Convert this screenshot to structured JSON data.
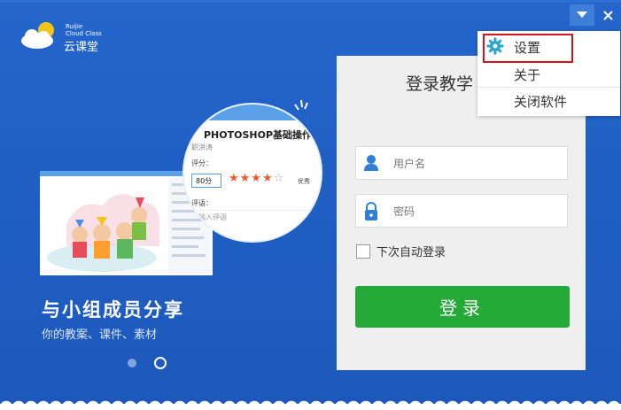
{
  "brand": {
    "name_en_1": "Ruijie",
    "name_en_2": "Cloud Class",
    "name_cn": "云课堂"
  },
  "window_controls": {
    "menu_icon": "chevron-down-icon",
    "close_icon": "close-icon"
  },
  "menu": {
    "items": [
      {
        "label": "设置",
        "icon": "gear-icon"
      },
      {
        "label": "关于"
      },
      {
        "label": "关闭软件"
      }
    ]
  },
  "slide": {
    "title": "与小组成员分享",
    "subtitle": "你的教案、课件、素材",
    "active_index": 1,
    "count": 2,
    "zoom": {
      "course_title": "PHOTOSHOP基础操作",
      "teacher": "职洪涛",
      "score_label": "评分：",
      "score_value": "80分",
      "stars": "★★★★",
      "star_off": "☆",
      "rating_text": "优秀",
      "comment_label": "评语：",
      "comment_placeholder": "请输入评语"
    }
  },
  "login": {
    "title": "登录教学",
    "username_placeholder": "用户名",
    "password_placeholder": "密码",
    "remember_label": "下次自动登录",
    "submit_label": "登录"
  },
  "colors": {
    "background": "#2062c8",
    "login_button": "#25aa38",
    "highlight": "#d5131a",
    "gear": "#2aa6c8",
    "field_icon": "#2d7fd8"
  }
}
